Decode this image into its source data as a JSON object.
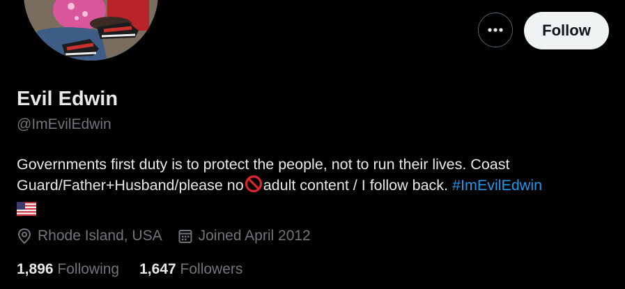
{
  "profile": {
    "display_name": "Evil Edwin",
    "handle": "@ImEvilEdwin",
    "bio": {
      "line1": "Governments first duty is to protect the people, not to run their lives. Coast",
      "line2_before_emoji": "Guard/Father+Husband/please no",
      "line2_after_emoji": "adult content / I follow back.",
      "hashtag": "#ImEvilEdwin",
      "emoji": "no-entry-icon",
      "flag": "us-flag-icon"
    },
    "location": "Rhode Island, USA",
    "joined": "Joined April 2012",
    "avatar": "profile-avatar-photo"
  },
  "actions": {
    "more_icon": "more-icon",
    "follow_label": "Follow"
  },
  "stats": {
    "following_count": "1,896",
    "following_label": "Following",
    "followers_count": "1,647",
    "followers_label": "Followers"
  },
  "colors": {
    "background": "#000000",
    "text_primary": "#e7e9ea",
    "text_secondary": "#71767b",
    "link": "#1d9bf0",
    "follow_button_bg": "#eff3f4",
    "border": "#536471"
  }
}
